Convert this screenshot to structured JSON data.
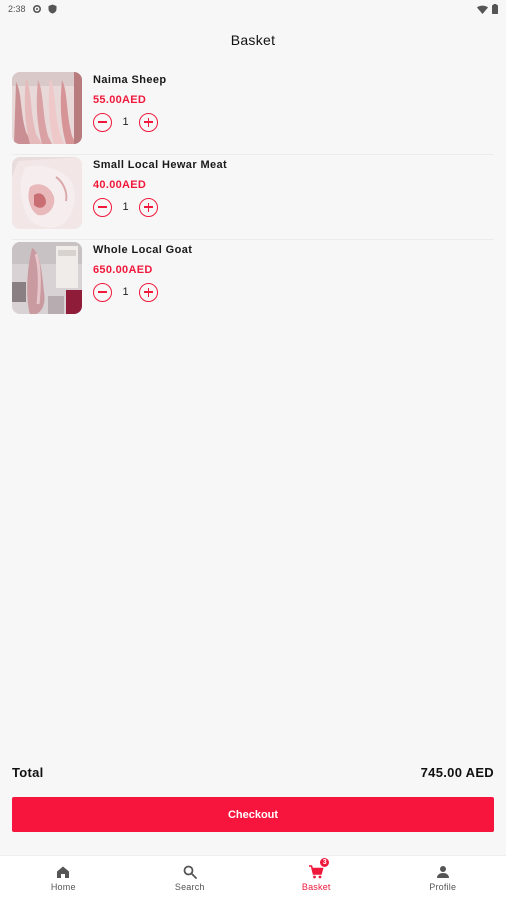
{
  "status_bar": {
    "time": "2:38",
    "icons": [
      "settings-icon",
      "shield-icon",
      "wifi-icon",
      "battery-icon"
    ]
  },
  "header": {
    "title": "Basket"
  },
  "basket": {
    "items": [
      {
        "name": "Naima Sheep",
        "price": "55.00AED",
        "quantity": "1",
        "image": "sheep-carcass-photo"
      },
      {
        "name": "Small Local Hewar Meat",
        "price": "40.00AED",
        "quantity": "1",
        "image": "meat-cut-photo"
      },
      {
        "name": "Whole Local Goat",
        "price": "650.00AED",
        "quantity": "1",
        "image": "goat-carcass-photo"
      }
    ]
  },
  "summary": {
    "total_label": "Total",
    "total_value": "745.00 AED"
  },
  "checkout": {
    "label": "Checkout"
  },
  "bottom_nav": {
    "items": [
      {
        "label": "Home",
        "icon": "home-icon"
      },
      {
        "label": "Search",
        "icon": "search-icon"
      },
      {
        "label": "Basket",
        "icon": "cart-icon",
        "badge": "3",
        "active": true
      },
      {
        "label": "Profile",
        "icon": "person-icon"
      }
    ]
  },
  "colors": {
    "accent": "#f0193c",
    "background": "#f7f7f7",
    "text": "#111111"
  }
}
